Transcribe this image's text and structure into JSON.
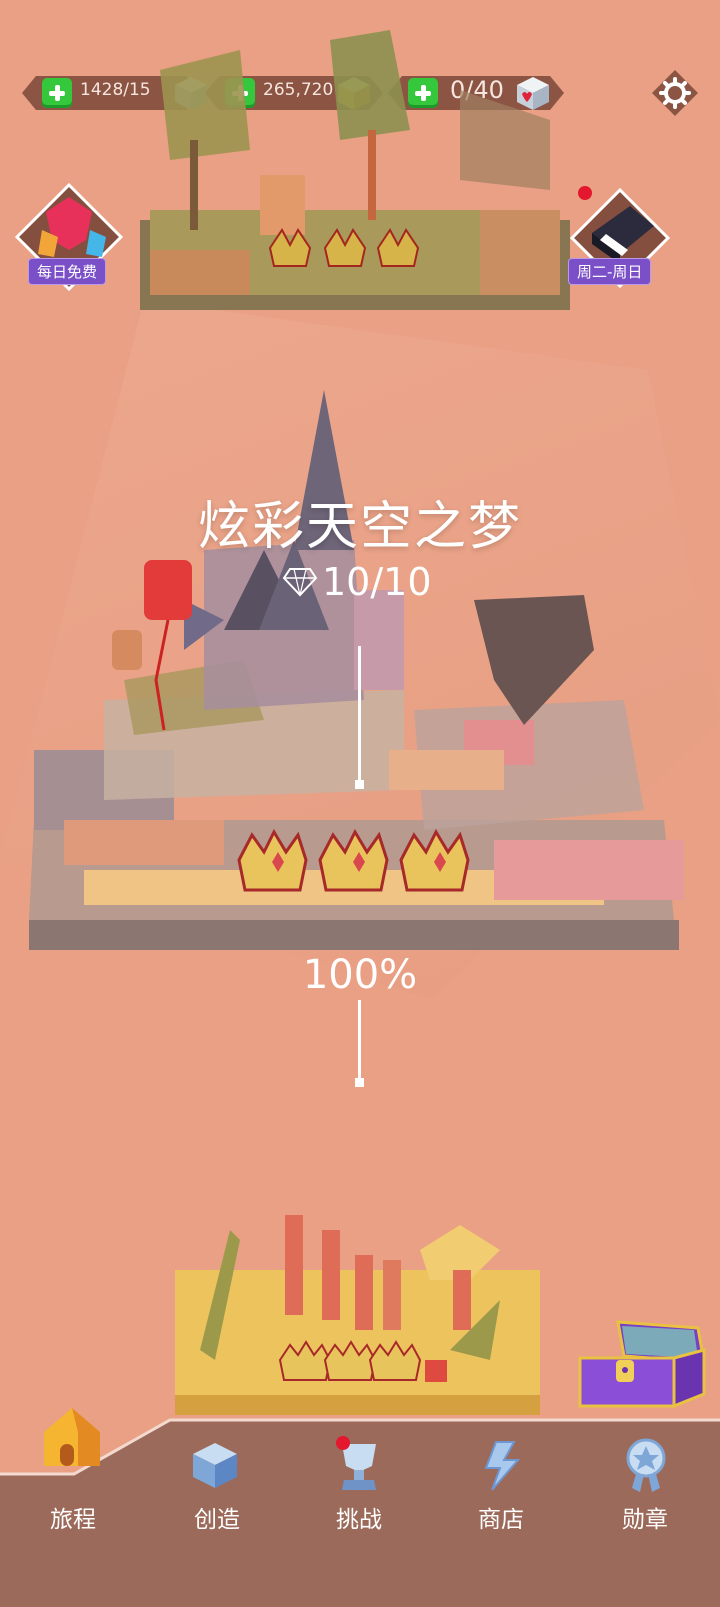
{
  "resources": [
    {
      "value": "1428/15",
      "icon": "ice-cube-icon"
    },
    {
      "value": "265,720",
      "icon": "gold-cube-icon"
    },
    {
      "value": "0/40",
      "icon": "heart-cube-icon"
    }
  ],
  "settings_icon": "gear-icon",
  "left_badge": {
    "label": "每日免费",
    "icon": "gem-balloon-icon"
  },
  "right_badge": {
    "label": "周二-周日",
    "icon": "piano-icon"
  },
  "level": {
    "title": "炫彩天空之梦",
    "gems": "10/10",
    "progress_text": "100%",
    "progress": 1.0
  },
  "nav": [
    {
      "label": "旅程",
      "icon": "house-icon",
      "active": true
    },
    {
      "label": "创造",
      "icon": "cube-icon"
    },
    {
      "label": "挑战",
      "icon": "trophy-icon"
    },
    {
      "label": "商店",
      "icon": "bolt-shop-icon"
    },
    {
      "label": "勋章",
      "icon": "medal-icon"
    }
  ],
  "colors": {
    "background": "#e9a084",
    "navbar": "#9c6a5a",
    "plus_green": "#35c83c",
    "badge_purple": "#7b4fc8"
  }
}
